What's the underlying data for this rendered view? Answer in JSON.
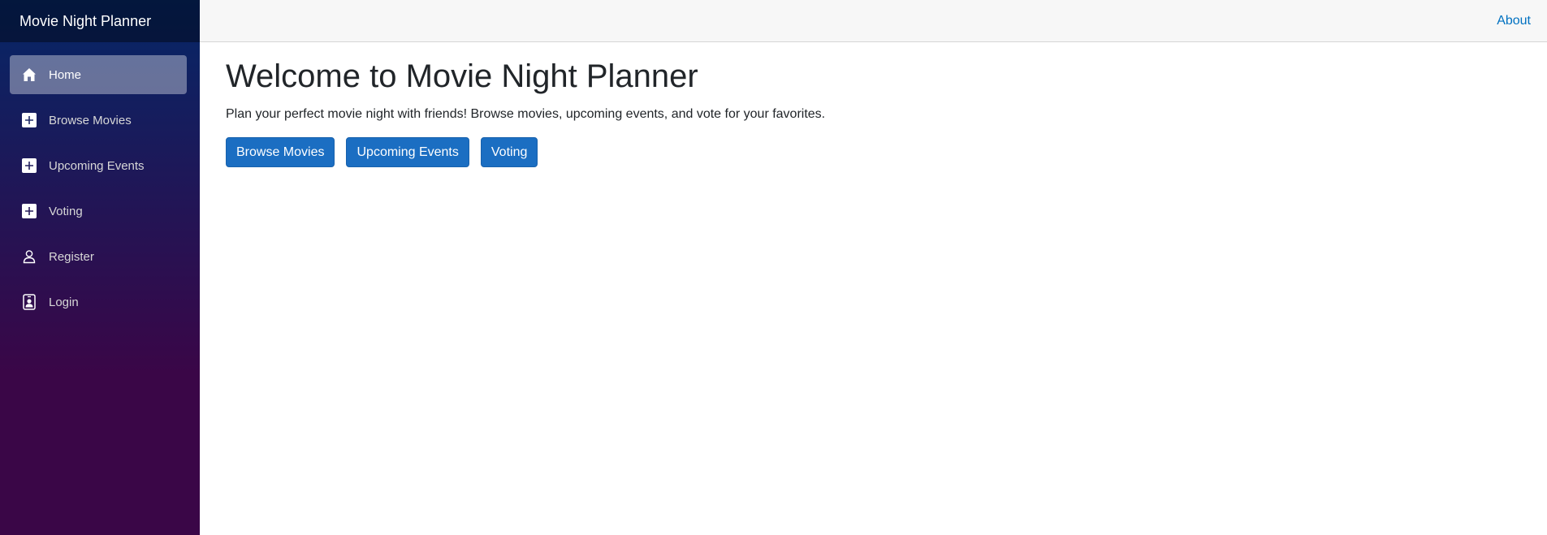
{
  "sidebar": {
    "brand": "Movie Night Planner",
    "items": [
      {
        "label": "Home",
        "icon": "home-icon",
        "active": true
      },
      {
        "label": "Browse Movies",
        "icon": "plus-square-icon"
      },
      {
        "label": "Upcoming Events",
        "icon": "plus-square-icon"
      },
      {
        "label": "Voting",
        "icon": "plus-square-icon"
      },
      {
        "label": "Register",
        "icon": "person-icon"
      },
      {
        "label": "Login",
        "icon": "person-badge-icon"
      }
    ]
  },
  "top_row": {
    "about_label": "About"
  },
  "main": {
    "title": "Welcome to Movie Night Planner",
    "lead": "Plan your perfect movie night with friends! Browse movies, upcoming events, and vote for your favorites.",
    "buttons": [
      {
        "label": "Browse Movies"
      },
      {
        "label": "Upcoming Events"
      },
      {
        "label": "Voting"
      }
    ]
  },
  "colors": {
    "sidebar_gradient_top": "#052767",
    "sidebar_gradient_bottom": "#3a0647",
    "button_primary": "#1b6ec2",
    "link": "#0071c1"
  }
}
